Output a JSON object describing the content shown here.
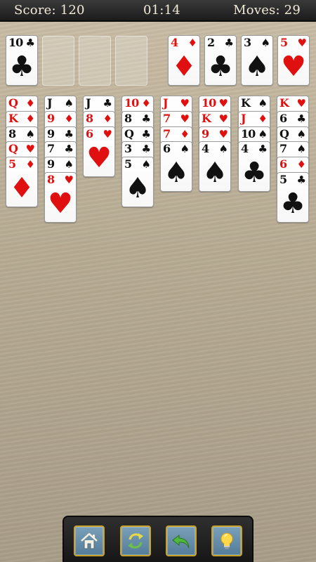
{
  "header": {
    "score": "Score: 120",
    "time": "01:14",
    "moves": "Moves: 29"
  },
  "colors": {
    "red": "#e01010",
    "black": "#111111"
  },
  "free_cells": [
    {
      "rank": "10",
      "suit": "♣",
      "color": "black"
    },
    null,
    null,
    null
  ],
  "foundations": [
    {
      "rank": "4",
      "suit": "♦",
      "color": "red"
    },
    {
      "rank": "2",
      "suit": "♣",
      "color": "black"
    },
    {
      "rank": "3",
      "suit": "♠",
      "color": "black"
    },
    {
      "rank": "5",
      "suit": "♥",
      "color": "red"
    }
  ],
  "tableau": [
    [
      {
        "rank": "Q",
        "suit": "♦",
        "color": "red"
      },
      {
        "rank": "K",
        "suit": "♦",
        "color": "red"
      },
      {
        "rank": "8",
        "suit": "♠",
        "color": "black"
      },
      {
        "rank": "Q",
        "suit": "♥",
        "color": "red"
      },
      {
        "rank": "5",
        "suit": "♦",
        "color": "red"
      }
    ],
    [
      {
        "rank": "J",
        "suit": "♠",
        "color": "black"
      },
      {
        "rank": "9",
        "suit": "♦",
        "color": "red"
      },
      {
        "rank": "9",
        "suit": "♣",
        "color": "black"
      },
      {
        "rank": "7",
        "suit": "♣",
        "color": "black"
      },
      {
        "rank": "9",
        "suit": "♠",
        "color": "black"
      },
      {
        "rank": "8",
        "suit": "♥",
        "color": "red"
      }
    ],
    [
      {
        "rank": "J",
        "suit": "♣",
        "color": "black"
      },
      {
        "rank": "8",
        "suit": "♦",
        "color": "red"
      },
      {
        "rank": "6",
        "suit": "♥",
        "color": "red"
      }
    ],
    [
      {
        "rank": "10",
        "suit": "♦",
        "color": "red"
      },
      {
        "rank": "8",
        "suit": "♣",
        "color": "black"
      },
      {
        "rank": "Q",
        "suit": "♣",
        "color": "black"
      },
      {
        "rank": "3",
        "suit": "♣",
        "color": "black"
      },
      {
        "rank": "5",
        "suit": "♠",
        "color": "black"
      }
    ],
    [
      {
        "rank": "J",
        "suit": "♥",
        "color": "red"
      },
      {
        "rank": "7",
        "suit": "♥",
        "color": "red"
      },
      {
        "rank": "7",
        "suit": "♦",
        "color": "red"
      },
      {
        "rank": "6",
        "suit": "♠",
        "color": "black"
      }
    ],
    [
      {
        "rank": "10",
        "suit": "♥",
        "color": "red"
      },
      {
        "rank": "K",
        "suit": "♥",
        "color": "red"
      },
      {
        "rank": "9",
        "suit": "♥",
        "color": "red"
      },
      {
        "rank": "4",
        "suit": "♠",
        "color": "black"
      }
    ],
    [
      {
        "rank": "K",
        "suit": "♠",
        "color": "black"
      },
      {
        "rank": "J",
        "suit": "♦",
        "color": "red"
      },
      {
        "rank": "10",
        "suit": "♠",
        "color": "black"
      },
      {
        "rank": "4",
        "suit": "♣",
        "color": "black"
      }
    ],
    [
      {
        "rank": "K",
        "suit": "♥",
        "color": "red"
      },
      {
        "rank": "6",
        "suit": "♣",
        "color": "black"
      },
      {
        "rank": "Q",
        "suit": "♠",
        "color": "black"
      },
      {
        "rank": "7",
        "suit": "♠",
        "color": "black"
      },
      {
        "rank": "6",
        "suit": "♦",
        "color": "red"
      },
      {
        "rank": "5",
        "suit": "♣",
        "color": "black"
      }
    ]
  ],
  "toolbar": {
    "buttons": [
      {
        "icon": "home-icon"
      },
      {
        "icon": "restart-icon"
      },
      {
        "icon": "undo-icon"
      },
      {
        "icon": "hint-icon"
      }
    ]
  }
}
